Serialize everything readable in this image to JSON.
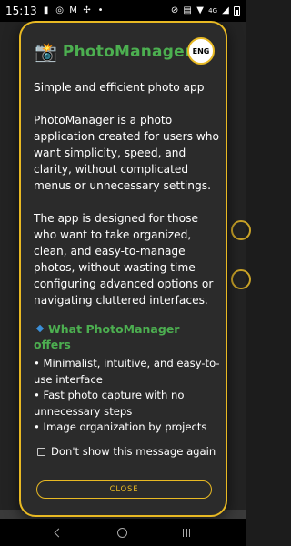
{
  "status_bar": {
    "time": "15:13",
    "icons_left": [
      "notification-icon",
      "whatsapp-icon",
      "gmail-icon",
      "pinwheel-icon",
      "dot-icon"
    ],
    "icons_right": [
      "silent-icon",
      "volte-icon",
      "wifi-icon",
      "signal-icon",
      "battery-icon"
    ],
    "signal_label": "4G"
  },
  "dialog": {
    "logo": "📸",
    "app_title": "PhotoManager",
    "lang_button": "ENG",
    "tagline": "Simple and efficient photo app",
    "paragraph1": "PhotoManager is a photo application created for users who want simplicity, speed, and clarity, without complicated menus or unnecessary settings.",
    "paragraph2": "The app is designed for those who want to take organized, clean, and easy-to-manage photos, without wasting time configuring advanced options or navigating cluttered interfaces.",
    "section_title": "What PhotoManager offers",
    "features": [
      "• Minimalist, intuitive, and easy-to-use interface",
      "• Fast photo capture with no unnecessary steps",
      "• Image organization by projects"
    ],
    "checkbox_label": "Don't show this message again",
    "checkbox_checked": false,
    "close_button": "CLOSE"
  },
  "colors": {
    "accent": "#e8b923",
    "title_green": "#4caf50",
    "dialog_bg": "#2b2b2b",
    "diamond_blue": "#3b8fd8"
  }
}
